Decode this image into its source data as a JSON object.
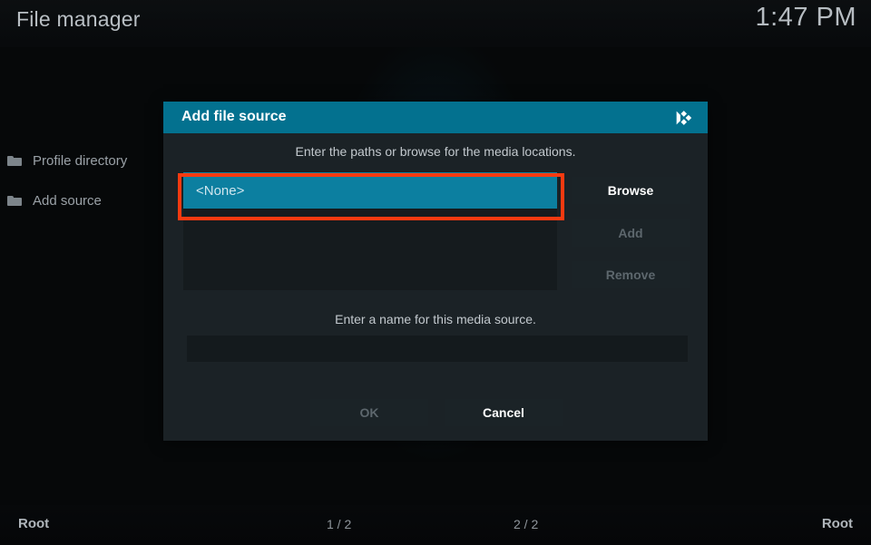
{
  "topbar": {
    "title": "File manager",
    "clock": "1:47 PM"
  },
  "sidebar": {
    "items": [
      {
        "label": "Profile directory",
        "icon": "folder-icon"
      },
      {
        "label": "Add source",
        "icon": "folder-icon"
      }
    ]
  },
  "statusbar": {
    "left_root": "Root",
    "left_count": "1 / 2",
    "right_count": "2 / 2",
    "right_root": "Root"
  },
  "dialog": {
    "title": "Add file source",
    "logo_icon": "kodi-logo-icon",
    "hint_paths": "Enter the paths or browse for the media locations.",
    "hint_name": "Enter a name for this media source.",
    "path_list": {
      "rows": [
        {
          "label": "<None>",
          "selected": true
        }
      ]
    },
    "side_buttons": [
      {
        "label": "Browse",
        "enabled": true
      },
      {
        "label": "Add",
        "enabled": false
      },
      {
        "label": "Remove",
        "enabled": false
      }
    ],
    "name_field": {
      "value": "",
      "placeholder": ""
    },
    "footer_buttons": [
      {
        "label": "OK",
        "enabled": false
      },
      {
        "label": "Cancel",
        "enabled": true
      }
    ]
  },
  "colors": {
    "accent_teal": "#03718f",
    "selection_teal": "#0c7fa0",
    "dialog_bg": "#1b2226",
    "annotation_red": "#f83a10",
    "text_primary": "#ffffff",
    "text_muted": "#5d676d"
  }
}
